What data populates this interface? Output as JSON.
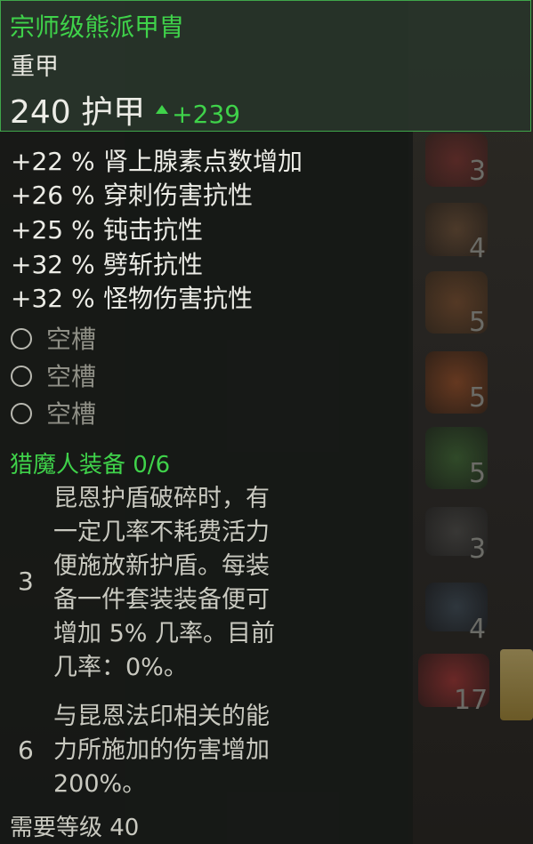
{
  "tooltip": {
    "title": "宗师级熊派甲胄",
    "type": "重甲",
    "armor_value": "240 护甲",
    "armor_delta": "+239",
    "stats": [
      {
        "value": "+22 %",
        "label": "肾上腺素点数增加"
      },
      {
        "value": "+26 %",
        "label": "穿刺伤害抗性"
      },
      {
        "value": "+25 %",
        "label": "钝击抗性"
      },
      {
        "value": "+32 %",
        "label": "劈斩抗性"
      },
      {
        "value": "+32 %",
        "label": "怪物伤害抗性"
      }
    ],
    "slots": [
      "空槽",
      "空槽",
      "空槽"
    ],
    "set_title": "猎魔人装备 0/6",
    "set_bonuses": [
      {
        "pieces": "3",
        "lines": [
          "昆恩护盾破碎时，有",
          "一定几率不耗费活力",
          "便施放新护盾。每装",
          "备一件套装装备便可",
          "增加 5% 几率。目前",
          "几率：0%。"
        ]
      },
      {
        "pieces": "6",
        "lines": [
          "与昆恩法印相关的能",
          "力所施加的伤害增加",
          "200%。"
        ]
      }
    ],
    "requirement": "需要等级 40"
  },
  "inventory_counts": [
    "3",
    "4",
    "5",
    "5",
    "5",
    "3",
    "4",
    "17"
  ],
  "colors": {
    "accent_green": "#3fd24a",
    "border_green": "#3fa64a"
  }
}
